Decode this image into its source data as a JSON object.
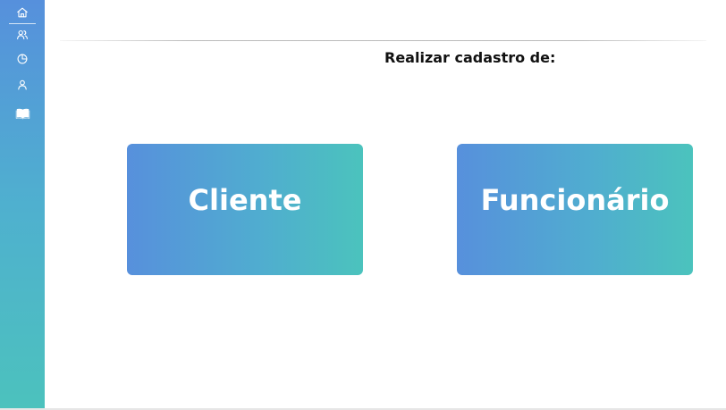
{
  "sidebar": {
    "items": [
      {
        "icon": "home-icon",
        "active": true
      },
      {
        "icon": "users-icon",
        "active": false
      },
      {
        "icon": "clock-icon",
        "active": false
      },
      {
        "icon": "user-icon",
        "active": false
      },
      {
        "icon": "book-icon",
        "active": false
      }
    ],
    "gradient": [
      "#5690dc",
      "#4cc2bd"
    ]
  },
  "main": {
    "heading": "Realizar cadastro de:",
    "cards": [
      {
        "label": "Cliente"
      },
      {
        "label": "Funcionário"
      }
    ],
    "card_gradient": [
      "#5790dc",
      "#4bc3bd"
    ]
  }
}
